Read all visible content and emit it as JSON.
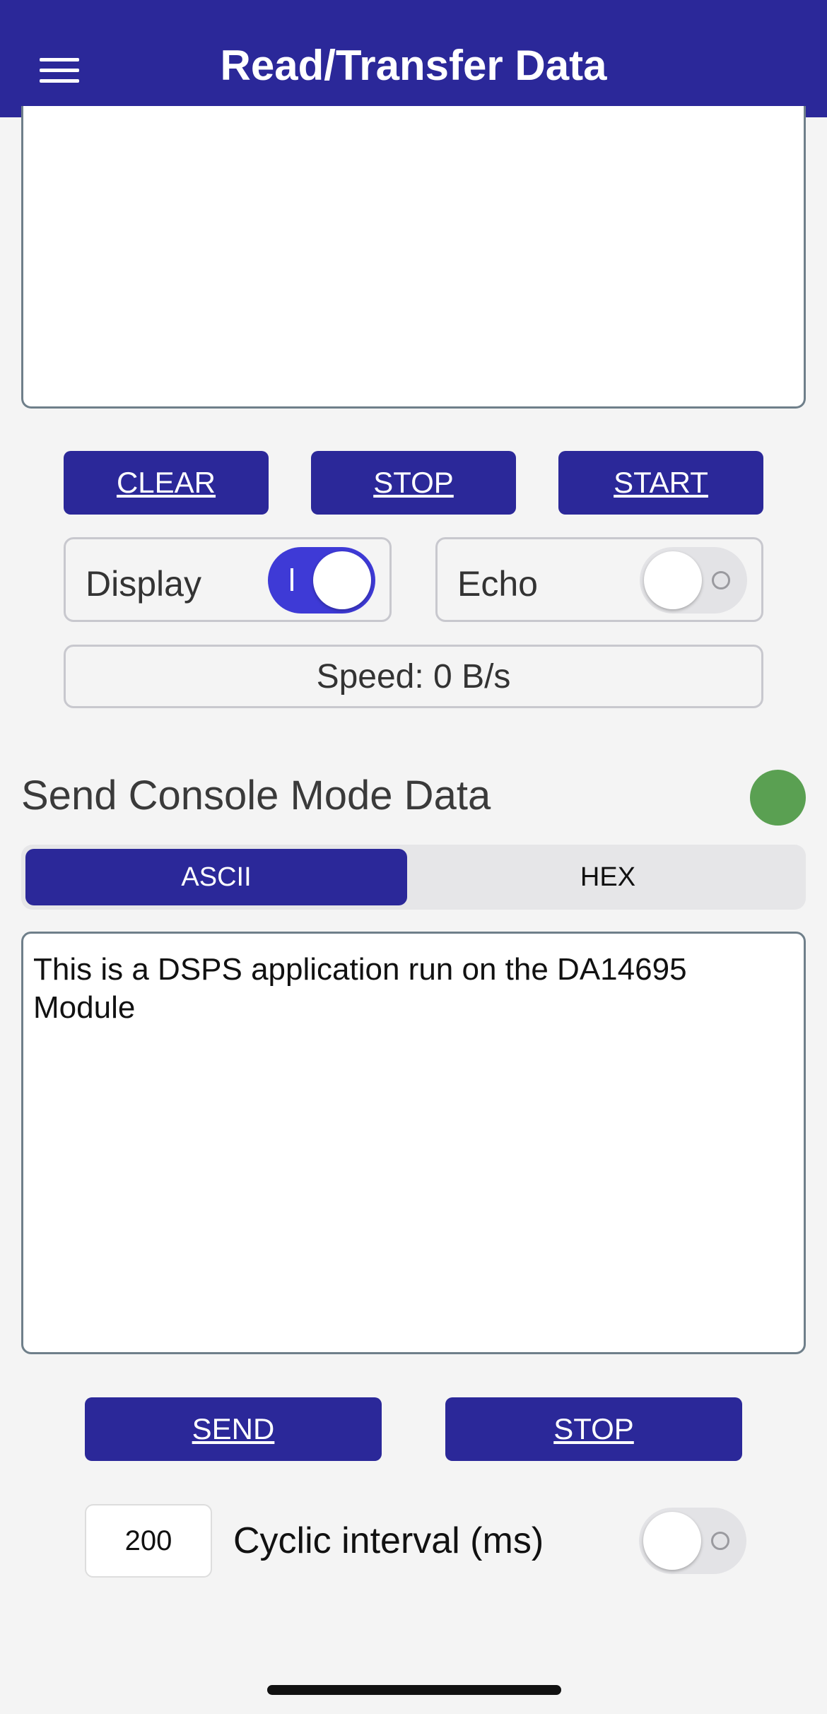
{
  "header": {
    "title": "Read/Transfer Data",
    "menu_icon": "hamburger-menu-icon"
  },
  "log": {
    "content": ""
  },
  "receive_controls": {
    "clear_label": "CLEAR",
    "stop_label": "STOP",
    "start_label": "START"
  },
  "toggles": {
    "display": {
      "label": "Display",
      "state": "on"
    },
    "echo": {
      "label": "Echo",
      "state": "off"
    }
  },
  "speed": {
    "text": "Speed: 0 B/s"
  },
  "send_section": {
    "title": "Send Console Mode Data",
    "status_color": "#5aa052",
    "tabs": {
      "ascii": "ASCII",
      "hex": "HEX",
      "selected": "ASCII"
    },
    "text": "This is a DSPS application run on the DA14695 Module",
    "send_label": "SEND",
    "stop_label": "STOP",
    "cyclic": {
      "value": "200",
      "label": "Cyclic interval (ms)",
      "state": "off"
    }
  },
  "colors": {
    "accent": "#2b2899",
    "toggle_on": "#3e3ad6",
    "background": "#f4f4f4"
  }
}
